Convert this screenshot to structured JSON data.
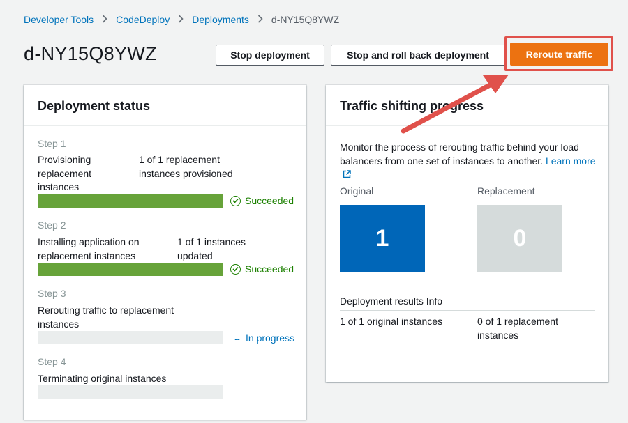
{
  "breadcrumb": {
    "items": [
      "Developer Tools",
      "CodeDeploy",
      "Deployments"
    ],
    "current": "d-NY15Q8YWZ"
  },
  "page_title": "d-NY15Q8YWZ",
  "actions": {
    "stop": "Stop deployment",
    "rollback": "Stop and roll back deployment",
    "reroute": "Reroute traffic"
  },
  "deployment_status": {
    "title": "Deployment status",
    "steps": [
      {
        "label": "Step 1",
        "name": "Provisioning replacement instances",
        "detail": "1 of 1 replacement instances provisioned",
        "progress": 1.0,
        "status": "Succeeded"
      },
      {
        "label": "Step 2",
        "name": "Installing application on replacement instances",
        "detail": "1 of 1 instances updated",
        "progress": 1.0,
        "status": "Succeeded"
      },
      {
        "label": "Step 3",
        "name": "Rerouting traffic to replacement instances",
        "detail": "",
        "progress": 0.0,
        "status": "In progress"
      },
      {
        "label": "Step 4",
        "name": "Terminating original instances",
        "detail": "",
        "progress": 0.0,
        "status": ""
      }
    ]
  },
  "traffic": {
    "title": "Traffic shifting progress",
    "description": "Monitor the process of rerouting traffic behind your load balancers from one set of instances to another.",
    "learn_more": "Learn more",
    "original_label": "Original",
    "original_count": "1",
    "replacement_label": "Replacement",
    "replacement_count": "0",
    "results_label": "Deployment results Info",
    "original_result": "1 of 1 original instances",
    "replacement_result": "0 of 1 replacement instances"
  },
  "colors": {
    "primary_button": "#ec7211",
    "highlight_frame": "#e0514b",
    "success": "#1d8102",
    "progress_fill": "#67a33a",
    "link": "#0073bb",
    "original_tile": "#0066b8",
    "replacement_tile": "#d5dbdb"
  },
  "icons": {
    "breadcrumb_separator": "chevron-right-icon",
    "success": "check-circle-icon",
    "in_progress": "spinner-icon",
    "external_link": "external-link-icon",
    "annotation": "arrow-icon"
  }
}
